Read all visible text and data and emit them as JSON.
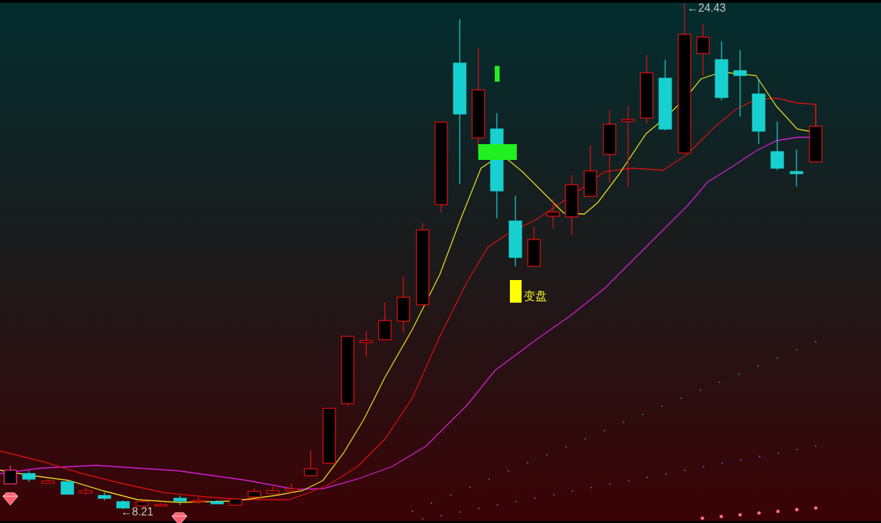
{
  "chart": {
    "price_labels": [
      {
        "kind": "high",
        "text": "←24.43"
      },
      {
        "kind": "low",
        "text": "←8.21"
      }
    ],
    "signal": {
      "text": "变盘"
    }
  }
}
